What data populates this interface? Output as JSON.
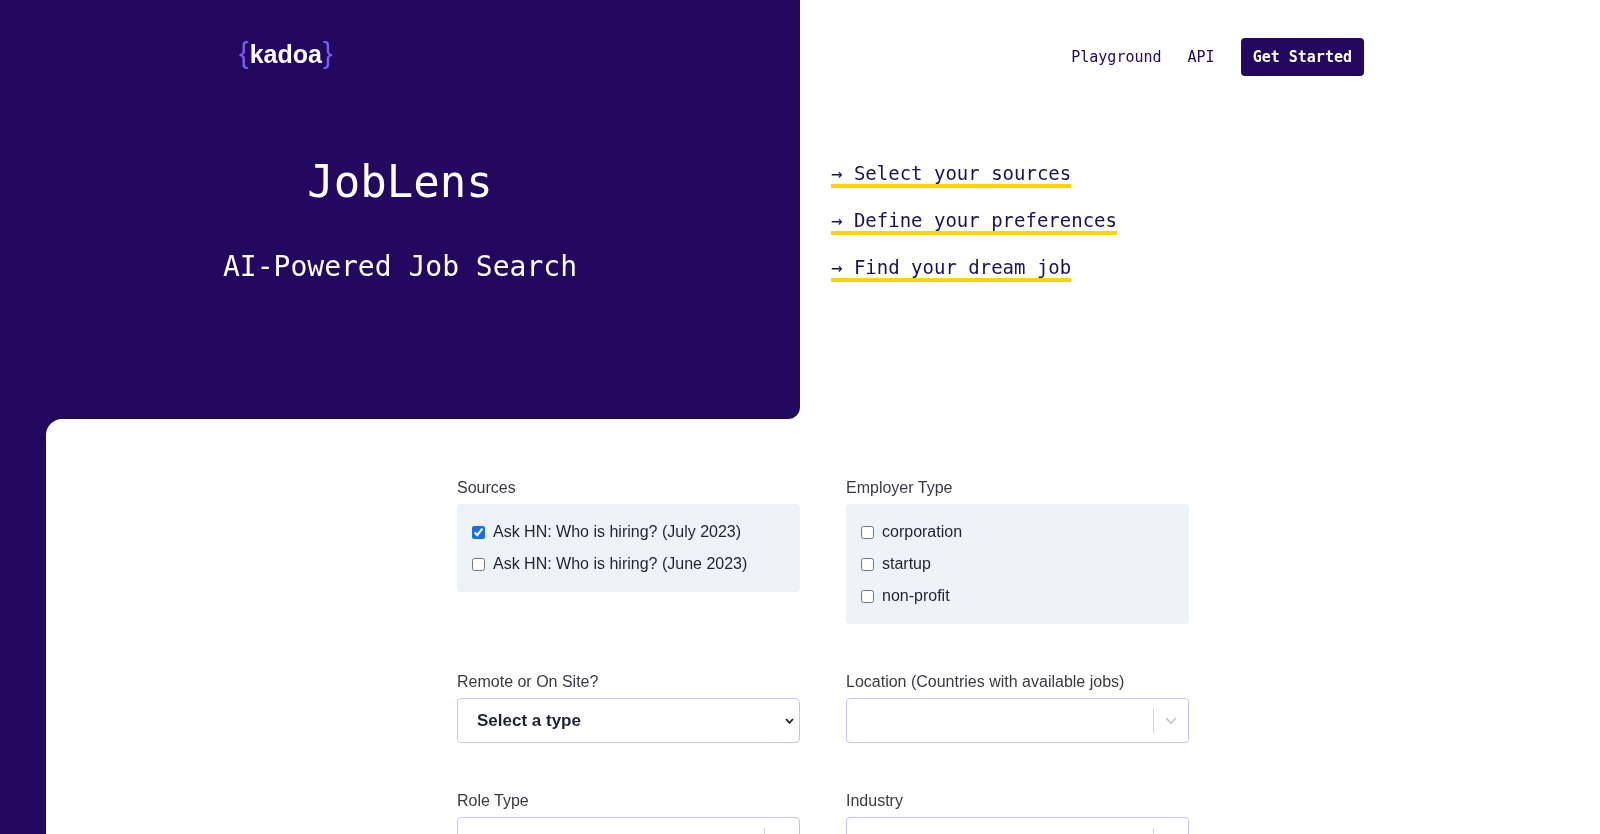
{
  "header": {
    "logo": {
      "open_brace": "{",
      "name": "kadoa",
      "close_brace": "}"
    },
    "nav_links": [
      {
        "label": "Playground"
      },
      {
        "label": "API"
      }
    ],
    "cta_button": {
      "label": "Get Started"
    }
  },
  "hero": {
    "title": "JobLens",
    "subtitle": "AI-Powered Job Search"
  },
  "steps": [
    {
      "text": "→ Select your sources"
    },
    {
      "text": "→ Define your preferences"
    },
    {
      "text": "→ Find your dream job"
    }
  ],
  "form": {
    "fields": [
      {
        "kind": "checkbox_group",
        "label": "Sources",
        "options": [
          {
            "label": "Ask HN: Who is hiring? (July 2023)",
            "checked": true
          },
          {
            "label": "Ask HN: Who is hiring? (June 2023)",
            "checked": false
          }
        ]
      },
      {
        "kind": "checkbox_group",
        "label": "Employer Type",
        "options": [
          {
            "label": "corporation",
            "checked": false
          },
          {
            "label": "startup",
            "checked": false
          },
          {
            "label": "non-profit",
            "checked": false
          }
        ]
      },
      {
        "kind": "select",
        "label": "Remote or On Site?",
        "value": "Select a type"
      },
      {
        "kind": "combobox",
        "label": "Location (Countries with available jobs)"
      },
      {
        "kind": "combobox",
        "label": "Role Type"
      },
      {
        "kind": "combobox",
        "label": "Industry"
      }
    ]
  }
}
